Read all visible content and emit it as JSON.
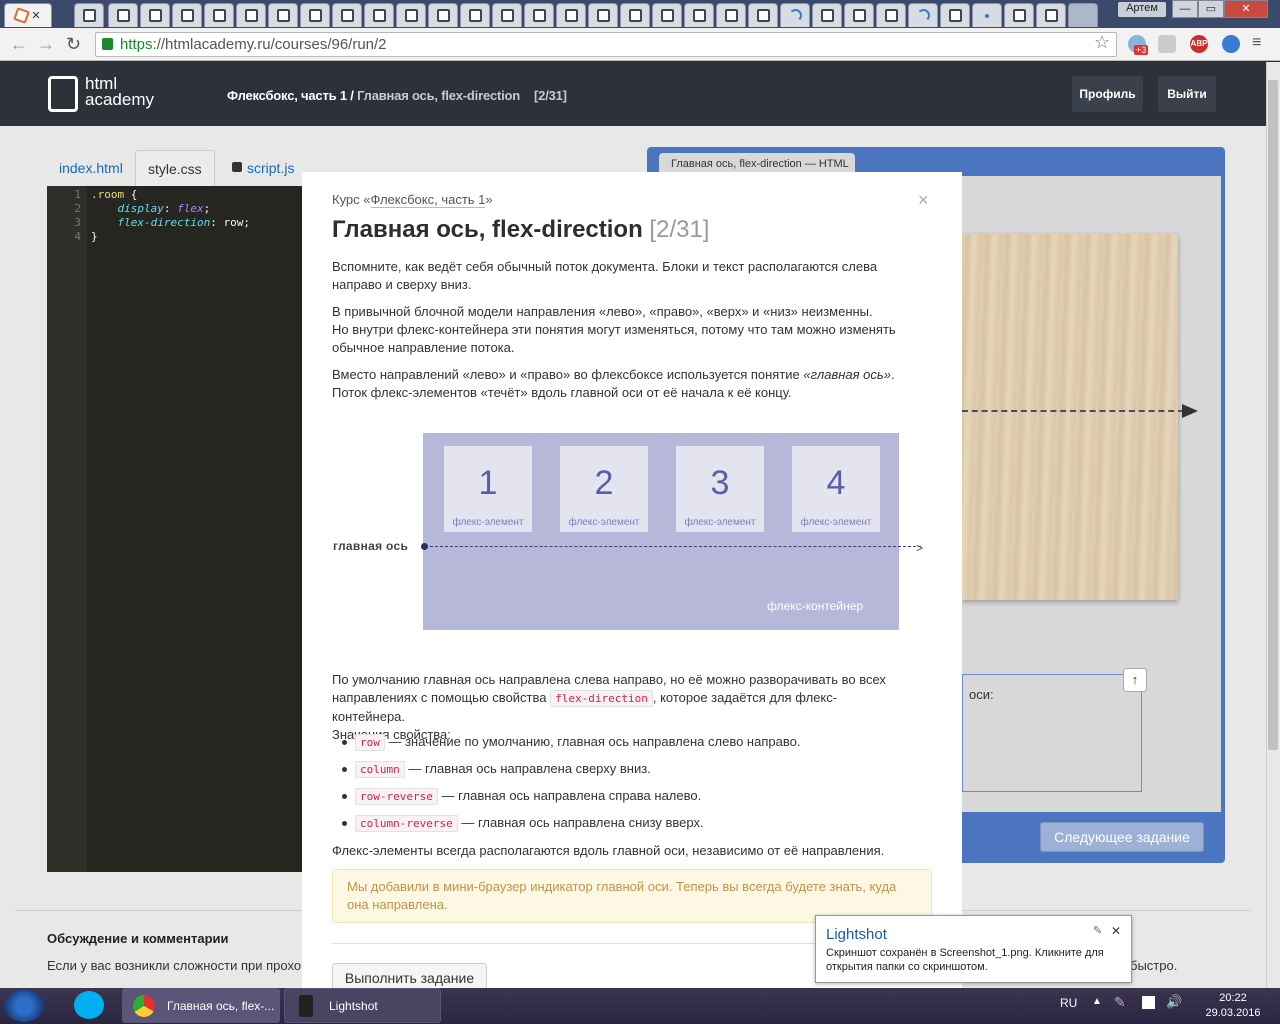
{
  "browser": {
    "user_label": "Артем",
    "win_min": "—",
    "win_max": "▭",
    "win_close": "✕",
    "url_scheme": "https",
    "url_rest": "://htmlacademy.ru/courses/96/run/2",
    "ext_badge": "+3",
    "adblock": "ABP"
  },
  "header": {
    "logo_line1": "html",
    "logo_line2": "academy",
    "course": "Флексбокс, часть 1",
    "separator": " / ",
    "lesson": "Главная ось, flex-direction",
    "counter": "[2/31]",
    "profile": "Профиль",
    "logout": "Выйти"
  },
  "editor": {
    "tabs": [
      "index.html",
      "style.css",
      "script.js"
    ],
    "line_numbers": "1\n2\n3\n4",
    "code": {
      "l1_sel": ".room",
      "l1_rest": " {",
      "l2_prop": "display",
      "l2_val": "flex",
      "l3_prop": "flex-direction",
      "l3_val": "row",
      "l4": "}"
    }
  },
  "preview": {
    "tab_title": "Главная ось, flex-direction — HTML",
    "task_text": "оси:",
    "next_button": "Следующее задание"
  },
  "discussion": {
    "title": "Обсуждение и комментарии",
    "text": "Если у вас возникли сложности при прохо",
    "tail": "быстро."
  },
  "modal": {
    "course_prefix": "Курс «",
    "course_link": "Флексбокс, часть 1",
    "course_suffix": "»",
    "title": "Главная ось, flex-direction",
    "title_count": "[2/31]",
    "p1": "Вспомните, как ведёт себя обычный поток документа. Блоки и текст располагаются слева направо и сверху вниз.",
    "p2a": "В привычной блочной модели направления «лево», «право», «верх» и «низ» неизменны.",
    "p2b": "Но внутри флекс-контейнера эти понятия могут изменяться, потому что там можно изменять обычное направление потока.",
    "p3a": "Вместо направлений «лево» и «право» во флексбоксе используется понятие ",
    "p3_em": "«главная ось»",
    "p3b": ".",
    "p3c": "Поток флекс-элементов «течёт» вдоль главной оси от её начала к её концу.",
    "diagram": {
      "items": [
        {
          "num": "1",
          "label": "флекс-элемент"
        },
        {
          "num": "2",
          "label": "флекс-элемент"
        },
        {
          "num": "3",
          "label": "флекс-элемент"
        },
        {
          "num": "4",
          "label": "флекс-элемент"
        }
      ],
      "axis_label": "главная ось",
      "container_label": "флекс-контейнер"
    },
    "p4a": "По умолчанию главная ось направлена слева направо, но её можно разворачивать во всех направлениях с помощью свойства ",
    "p4_code": "flex-direction",
    "p4b": ", которое задаётся для флекс-контейнера.",
    "p4c": "Значения свойства:",
    "values": [
      {
        "code": "row",
        "text": " — значение по умолчанию, главная ось направлена слево направо."
      },
      {
        "code": "column",
        "text": " — главная ось направлена сверху вниз."
      },
      {
        "code": "row-reverse",
        "text": " — главная ось направлена справа налево."
      },
      {
        "code": "column-reverse",
        "text": " — главная ось направлена снизу вверх."
      }
    ],
    "p5": "Флекс-элементы всегда располагаются вдоль главной оси, независимо от её направления.",
    "note": "Мы добавили в мини-браузер индикатор главной оси. Теперь вы всегда будете знать, куда она направлена.",
    "do_button": "Выполнить задание",
    "close": "×"
  },
  "lightshot": {
    "title": "Lightshot",
    "text": "Скриншот сохранён в Screenshot_1.png. Кликните для открытия папки со скриншотом."
  },
  "taskbar": {
    "chrome_label": "Главная ось, flex-...",
    "lightshot_label": "Lightshot",
    "lang": "RU",
    "time": "20:22",
    "date": "29.03.2016"
  }
}
